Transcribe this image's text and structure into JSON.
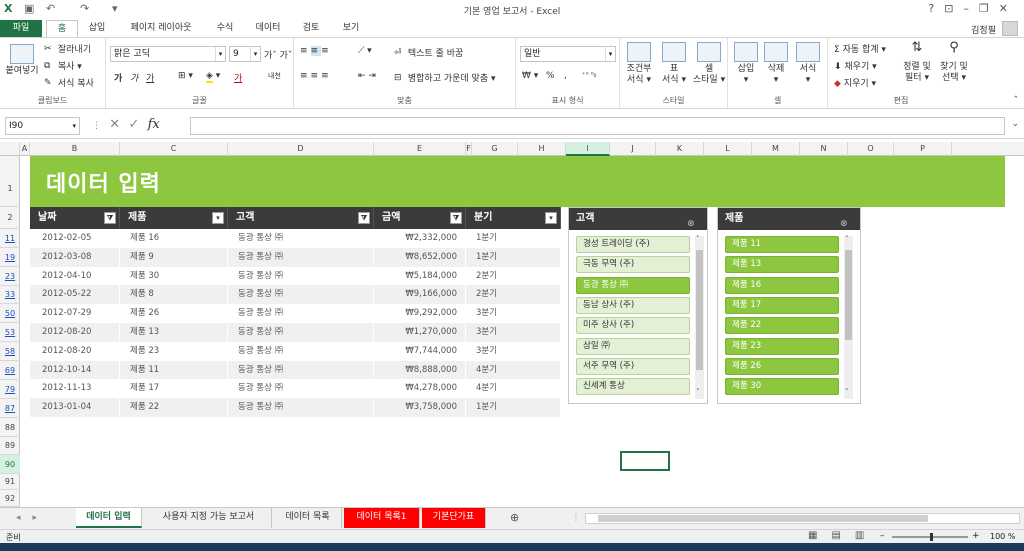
{
  "window": {
    "title": "기본 영업 보고서 - Excel",
    "help": "?"
  },
  "ribbon_tabs": [
    {
      "label": "파일"
    },
    {
      "label": "홈"
    },
    {
      "label": "삽입"
    },
    {
      "label": "페이지 레이아웃"
    },
    {
      "label": "수식"
    },
    {
      "label": "데이터"
    },
    {
      "label": "검토"
    },
    {
      "label": "보기"
    }
  ],
  "user": {
    "name": "김정필"
  },
  "ribbon": {
    "clipboard": {
      "paste": "붙여넣기",
      "cut": "잘라내기",
      "copy": "복사",
      "format_painter": "서식 복사",
      "label": "클립보드"
    },
    "font": {
      "name": "맑은 고딕",
      "size": "9",
      "bold": "가",
      "italic": "가",
      "underline": "가",
      "color_a": "가",
      "phonetic": "내천",
      "label": "글꼴"
    },
    "alignment": {
      "wrap": "텍스트 줄 바꿈",
      "merge": "병합하고 가운데 맞춤",
      "label": "맞춤"
    },
    "number": {
      "format": "일반",
      "percent": "%",
      "comma": ",",
      "label": "표시 형식"
    },
    "styles": {
      "conditional": "조건부\n서식",
      "table": "표\n서식",
      "cell": "셀\n스타일",
      "label": "스타일"
    },
    "cells": {
      "insert": "삽입",
      "delete": "삭제",
      "format": "서식",
      "label": "셀"
    },
    "editing": {
      "autosum": "자동 합계",
      "fill": "채우기",
      "clear": "지우기",
      "sort": "정렬 및\n필터",
      "find": "찾기 및\n선택",
      "label": "편집"
    }
  },
  "formula_bar": {
    "name_box": "I90",
    "fx": "fx",
    "value": ""
  },
  "columns": [
    "A",
    "B",
    "C",
    "D",
    "E",
    "F",
    "G",
    "H",
    "I",
    "J",
    "K",
    "L",
    "M",
    "N",
    "O",
    "P"
  ],
  "selected_column": "I",
  "rows": [
    "1",
    "2",
    "11",
    "19",
    "23",
    "33",
    "50",
    "53",
    "58",
    "69",
    "79",
    "87",
    "88",
    "89",
    "90",
    "91",
    "92"
  ],
  "selected_row": "90",
  "banner": {
    "title": "데이터 입력"
  },
  "table": {
    "headers": [
      "날짜",
      "제품",
      "고객",
      "금액",
      "분기"
    ],
    "rows": [
      [
        "2012-02-05",
        "제품 16",
        "동광 통상 ㈜",
        "₩2,332,000",
        "1분기"
      ],
      [
        "2012-03-08",
        "제품 9",
        "동광 통상 ㈜",
        "₩8,652,000",
        "1분기"
      ],
      [
        "2012-04-10",
        "제품 30",
        "동광 통상 ㈜",
        "₩5,184,000",
        "2분기"
      ],
      [
        "2012-05-22",
        "제품 8",
        "동광 통상 ㈜",
        "₩9,166,000",
        "2분기"
      ],
      [
        "2012-07-29",
        "제품 26",
        "동광 통상 ㈜",
        "₩9,292,000",
        "3분기"
      ],
      [
        "2012-08-20",
        "제품 13",
        "동광 통상 ㈜",
        "₩1,270,000",
        "3분기"
      ],
      [
        "2012-08-20",
        "제품 23",
        "동광 통상 ㈜",
        "₩7,744,000",
        "3분기"
      ],
      [
        "2012-10-14",
        "제품 11",
        "동광 통상 ㈜",
        "₩8,888,000",
        "4분기"
      ],
      [
        "2012-11-13",
        "제품 17",
        "동광 통상 ㈜",
        "₩4,278,000",
        "4분기"
      ],
      [
        "2013-01-04",
        "제품 22",
        "동광 통상 ㈜",
        "₩3,758,000",
        "1분기"
      ]
    ]
  },
  "slicer_customer": {
    "title": "고객",
    "items": [
      {
        "label": "경성 트레이딩 (주)",
        "selected": false
      },
      {
        "label": "극동 무역 (주)",
        "selected": false
      },
      {
        "label": "동광 통상 ㈜",
        "selected": true
      },
      {
        "label": "동남 상사 (주)",
        "selected": false
      },
      {
        "label": "미주 상사 (주)",
        "selected": false
      },
      {
        "label": "삼일 ㈜",
        "selected": false
      },
      {
        "label": "서주 무역 (주)",
        "selected": false
      },
      {
        "label": "신세계 통상",
        "selected": false
      }
    ]
  },
  "slicer_product": {
    "title": "제품",
    "items": [
      {
        "label": "제품 11",
        "selected": true
      },
      {
        "label": "제품 13",
        "selected": true
      },
      {
        "label": "제품 16",
        "selected": true
      },
      {
        "label": "제품 17",
        "selected": true
      },
      {
        "label": "제품 22",
        "selected": true
      },
      {
        "label": "제품 23",
        "selected": true
      },
      {
        "label": "제품 26",
        "selected": true
      },
      {
        "label": "제품 30",
        "selected": true
      }
    ]
  },
  "sheet_tabs": [
    {
      "label": "데이터 입력",
      "state": "active"
    },
    {
      "label": "사용자 지정 가능 보고서",
      "state": "normal"
    },
    {
      "label": "데이터 목록",
      "state": "normal"
    },
    {
      "label": "데이터 목록1",
      "state": "red"
    },
    {
      "label": "기본단가표",
      "state": "red"
    }
  ],
  "status": {
    "ready": "준비",
    "zoom": "100 %"
  },
  "colors": {
    "accent": "#217346",
    "banner": "#8dc63f",
    "header": "#3b3b3b",
    "tab_red": "#ff0000"
  }
}
